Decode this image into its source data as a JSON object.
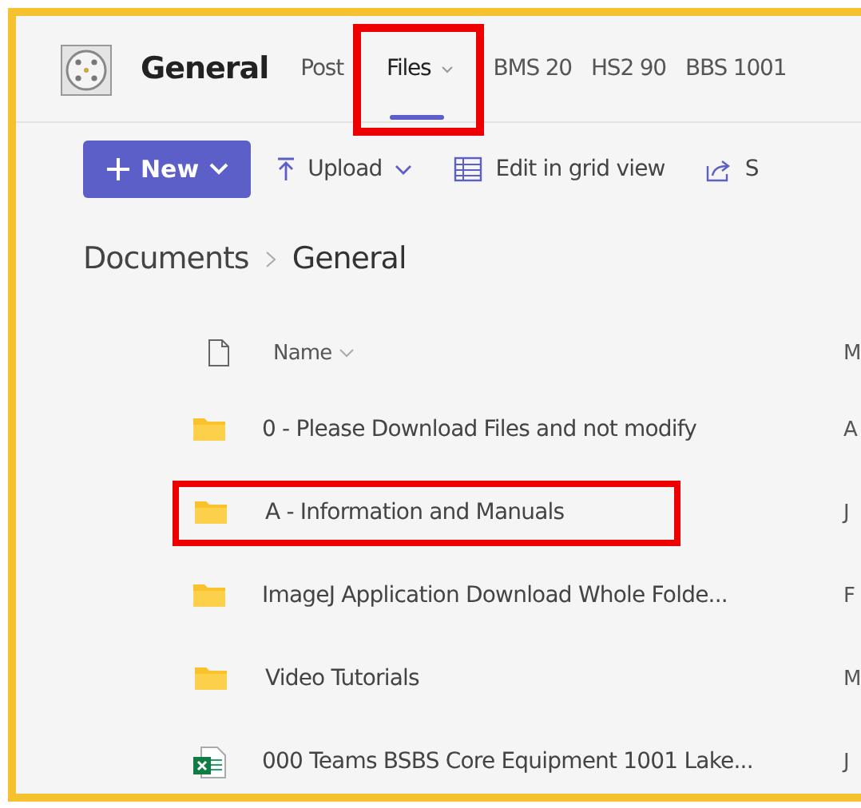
{
  "channel": {
    "name": "General"
  },
  "tabs": [
    {
      "label": "Post",
      "selected": false,
      "highlighted": false,
      "dropdown": false
    },
    {
      "label": "Files",
      "selected": true,
      "highlighted": true,
      "dropdown": true
    },
    {
      "label": "BMS 20",
      "selected": false,
      "highlighted": false,
      "dropdown": false
    },
    {
      "label": "HS2 90",
      "selected": false,
      "highlighted": false,
      "dropdown": false
    },
    {
      "label": "BBS 1001",
      "selected": false,
      "highlighted": false,
      "dropdown": false
    }
  ],
  "toolbar": [
    {
      "kind": "new",
      "label": "New"
    },
    {
      "kind": "upload",
      "label": "Upload"
    },
    {
      "kind": "grid",
      "label": "Edit in grid view"
    },
    {
      "kind": "share",
      "label": "S"
    }
  ],
  "breadcrumb": [
    "Documents",
    "General"
  ],
  "table": {
    "columns": [
      {
        "kind": "name",
        "label": "Name"
      },
      {
        "kind": "column_2",
        "label": "M"
      }
    ],
    "rows": [
      {
        "kind": "folder",
        "name": "0 - Please Download Files and not modify",
        "column_2": "A",
        "highlighted": false
      },
      {
        "kind": "folder",
        "name": "A - Information and Manuals",
        "column_2": "J",
        "highlighted": true
      },
      {
        "kind": "folder",
        "name": "ImageJ Application Download Whole Folde...",
        "column_2": "F",
        "highlighted": false
      },
      {
        "kind": "folder",
        "name": "Video Tutorials",
        "column_2": "M",
        "highlighted": false
      },
      {
        "kind": "excel",
        "name": "000 Teams BSBS Core Equipment 1001 Lake...",
        "column_2": "J",
        "highlighted": false
      }
    ]
  }
}
